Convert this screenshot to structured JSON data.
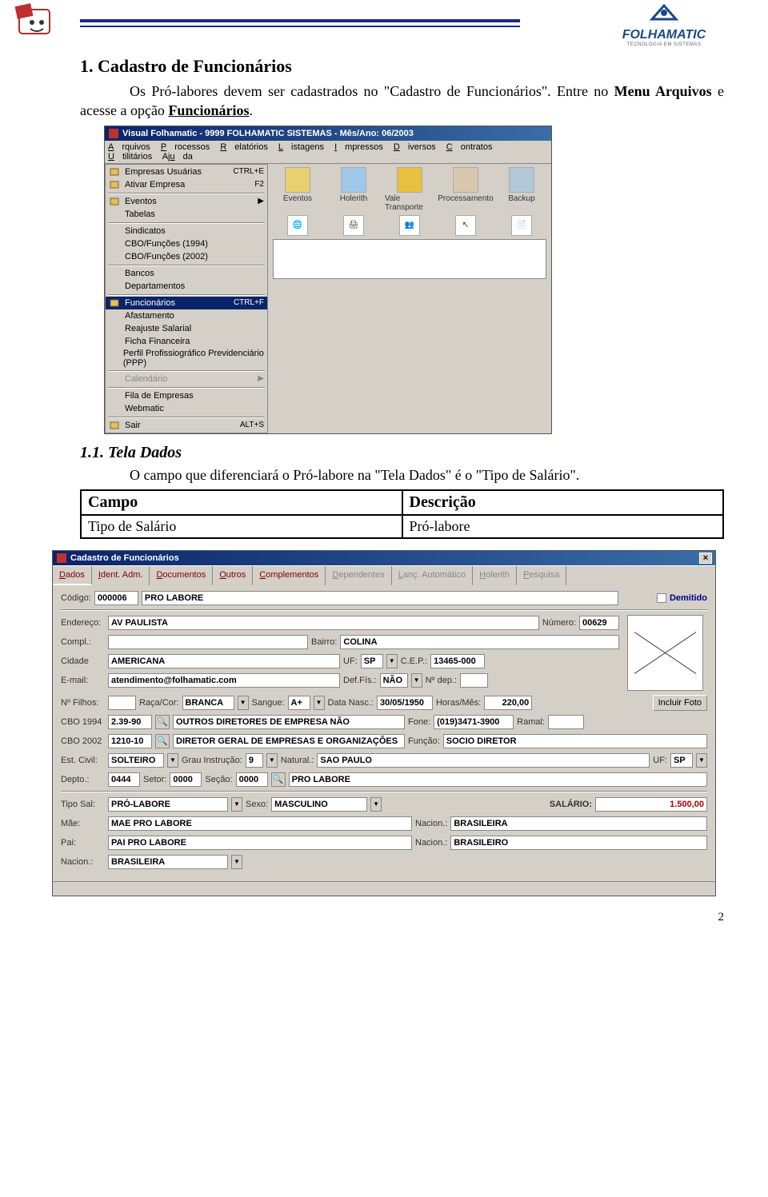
{
  "header": {
    "logo_text": "FOLHAMATIC",
    "logo_sub": "TECNOLOGIA EM SISTEMAS"
  },
  "section1": {
    "title": "1. Cadastro de Funcionários",
    "para1a": "Os Pró-labores devem ser cadastrados no \"Cadastro de Funcionários\". Entre no ",
    "para1b": "Menu Arquivos",
    "para1c": " e acesse a opção ",
    "para1d": "Funcionários",
    "para1e": "."
  },
  "win1": {
    "title": "Visual Folhamatic - 9999 FOLHAMATIC SISTEMAS - Mês/Ano: 06/2003",
    "menu": [
      "Arquivos",
      "Processos",
      "Relatórios",
      "Listagens",
      "Impressos",
      "Diversos",
      "Contratos",
      "Utilitários",
      "Ajuda"
    ],
    "dropdown": [
      {
        "label": "Empresas Usuárias",
        "shortcut": "CTRL+E",
        "icon": "folder"
      },
      {
        "label": "Ativar Empresa",
        "shortcut": "F2",
        "icon": "folder-open"
      },
      {
        "sep": true
      },
      {
        "label": "Eventos",
        "arrow": true,
        "icon": "event"
      },
      {
        "label": "Tabelas"
      },
      {
        "sep": true
      },
      {
        "label": "Sindicatos"
      },
      {
        "label": "CBO/Funções (1994)"
      },
      {
        "label": "CBO/Funções (2002)"
      },
      {
        "sep": true
      },
      {
        "label": "Bancos"
      },
      {
        "label": "Departamentos"
      },
      {
        "sep": true
      },
      {
        "label": "Funcionários",
        "shortcut": "CTRL+F",
        "selected": true,
        "icon": "person"
      },
      {
        "label": "Afastamento"
      },
      {
        "label": "Reajuste Salarial"
      },
      {
        "label": "Ficha Financeira"
      },
      {
        "label": "Perfil Profissiográfico Previdenciário (PPP)"
      },
      {
        "sep": true
      },
      {
        "label": "Calendário",
        "arrow": true,
        "disabled": true
      },
      {
        "sep": true
      },
      {
        "label": "Fila de Empresas"
      },
      {
        "label": "Webmatic"
      },
      {
        "sep": true
      },
      {
        "label": "Sair",
        "shortcut": "ALT+S",
        "icon": "exit"
      }
    ],
    "toolbar": [
      {
        "label": "Eventos",
        "color": "#e8d070"
      },
      {
        "label": "Holerith",
        "color": "#a0c8e8"
      },
      {
        "label": "Vale Transporte",
        "color": "#e8c040"
      },
      {
        "label": "Processamento",
        "color": "#d8c8b0"
      },
      {
        "label": "Backup",
        "color": "#b0c8d8"
      }
    ]
  },
  "section2": {
    "title": "1.1. Tela Dados",
    "para": "O campo que diferenciará o Pró-labore na \"Tela Dados\" é o \"Tipo de Salário\".",
    "table": {
      "h1": "Campo",
      "h2": "Descrição",
      "r1": "Tipo de Salário",
      "r2": "Pró-labore"
    }
  },
  "win2": {
    "title": "Cadastro de Funcionários",
    "tabs": [
      {
        "label": "Dados",
        "active": true
      },
      {
        "label": "Ident. Adm."
      },
      {
        "label": "Documentos"
      },
      {
        "label": "Outros"
      },
      {
        "label": "Complementos"
      },
      {
        "label": "Dependentes",
        "disabled": true
      },
      {
        "label": "Lanç. Automático",
        "disabled": true
      },
      {
        "label": "Holerith",
        "disabled": true
      },
      {
        "label": "Pesquisa",
        "disabled": true
      }
    ],
    "labels": {
      "codigo": "Código:",
      "demitido": "Demitido",
      "endereco": "Endereço:",
      "numero": "Número:",
      "compl": "Compl.:",
      "bairro": "Bairro:",
      "cidade": "Cidade",
      "uf": "UF:",
      "cep": "C.E.P.:",
      "email": "E-mail:",
      "deffis": "Def.Fís.:",
      "ndep": "Nº dep.:",
      "nfilhos": "Nº Filhos:",
      "raca": "Raça/Cor:",
      "sangue": "Sangue:",
      "datanasc": "Data Nasc.:",
      "horasmes": "Horas/Mês:",
      "incluirfoto": "Incluir Foto",
      "cbo1994": "CBO 1994",
      "fone": "Fone:",
      "ramal": "Ramal:",
      "cbo2002": "CBO 2002",
      "funcao": "Função:",
      "estcivil": "Est. Civil:",
      "grau": "Grau Instrução:",
      "natural": "Natural.:",
      "uf2": "UF:",
      "depto": "Depto.:",
      "setor": "Setor:",
      "secao": "Seção:",
      "tiposal": "Tipo Sal:",
      "sexo": "Sexo:",
      "salario": "SALÁRIO:",
      "mae": "Mãe:",
      "nacion": "Nacion.:",
      "pai": "Pai:",
      "nacion2": "Nacion.:",
      "nacion3": "Nacion.:"
    },
    "values": {
      "codigo": "000006",
      "nome": "PRO LABORE",
      "endereco": "AV PAULISTA",
      "numero": "00629",
      "compl": "",
      "bairro": "COLINA",
      "cidade": "AMERICANA",
      "uf": "SP",
      "cep": "13465-000",
      "email": "atendimento@folhamatic.com",
      "deffis": "NÃO",
      "ndep": "",
      "nfilhos": "",
      "raca": "BRANCA",
      "sangue": "A+",
      "datanasc": "30/05/1950",
      "horasmes": "220,00",
      "cbo1994_code": "2.39-90",
      "cbo1994_desc": "OUTROS DIRETORES DE EMPRESA NÃO CLASSIFICADA",
      "fone": "(019)3471-3900",
      "ramal": "",
      "cbo2002_code": "1210-10",
      "cbo2002_desc": "DIRETOR GERAL DE EMPRESAS E ORGANIZAÇÕES",
      "funcao": "SOCIO DIRETOR",
      "estcivil": "SOLTEIRO",
      "grau": "9",
      "natural": "SAO PAULO",
      "uf2": "SP",
      "depto": "0444",
      "setor": "0000",
      "secao": "0000",
      "depto_desc": "PRO LABORE",
      "tiposal": "PRÓ-LABORE",
      "sexo": "MASCULINO",
      "salario": "1.500,00",
      "mae": "MAE PRO LABORE",
      "mae_nacion": "BRASILEIRA",
      "pai": "PAI PRO LABORE",
      "pai_nacion": "BRASILEIRO",
      "nacion": "BRASILEIRA"
    }
  },
  "page_number": "2"
}
